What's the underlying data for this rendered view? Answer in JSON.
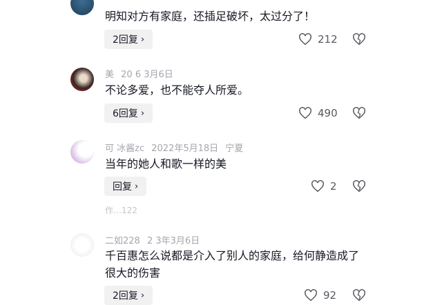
{
  "comments": [
    {
      "meta": {
        "name": "",
        "date": "",
        "location": ""
      },
      "text": "明知对方有家庭，还插足破坏，太过分了！",
      "reply_label": "2回复",
      "likes": "212"
    },
    {
      "meta": {
        "name": "美",
        "date": "20  6  3月6日",
        "location": ""
      },
      "text": "不论多爱，也不能夺人所爱。",
      "reply_label": "6回复",
      "likes": "490"
    },
    {
      "meta": {
        "name": "可  冰酱zc",
        "date": "2022年5月18日",
        "location": "宁夏"
      },
      "text": "当年的她人和歌一样的美",
      "reply_label": "回复",
      "likes": "2",
      "author_tag": "作…122"
    },
    {
      "meta": {
        "name": "二如228",
        "date": "2  3年3月6日",
        "location": ""
      },
      "text": "千百惠怎么说都是介入了别人的家庭，给何静造成了很大的伤害",
      "reply_label": "2回复",
      "likes": "92"
    }
  ]
}
